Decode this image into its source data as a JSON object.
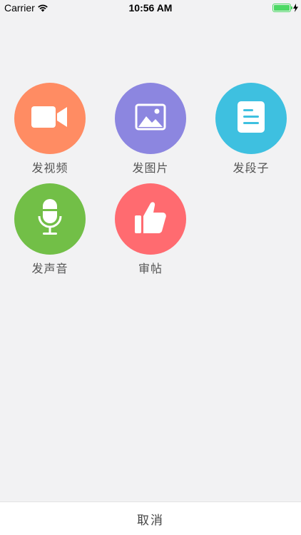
{
  "status_bar": {
    "carrier": "Carrier",
    "time": "10:56 AM",
    "battery_level": 1.0
  },
  "actions": [
    {
      "label": "发视频",
      "color": "#ff8c63",
      "icon": "video-camera-icon"
    },
    {
      "label": "发图片",
      "color": "#8c86e0",
      "icon": "image-icon"
    },
    {
      "label": "发段子",
      "color": "#3ec0e0",
      "icon": "document-text-icon"
    },
    {
      "label": "发声音",
      "color": "#72bf47",
      "icon": "microphone-icon"
    },
    {
      "label": "审帖",
      "color": "#ff6b70",
      "icon": "thumbs-up-icon"
    }
  ],
  "cancel": {
    "label": "取消"
  }
}
